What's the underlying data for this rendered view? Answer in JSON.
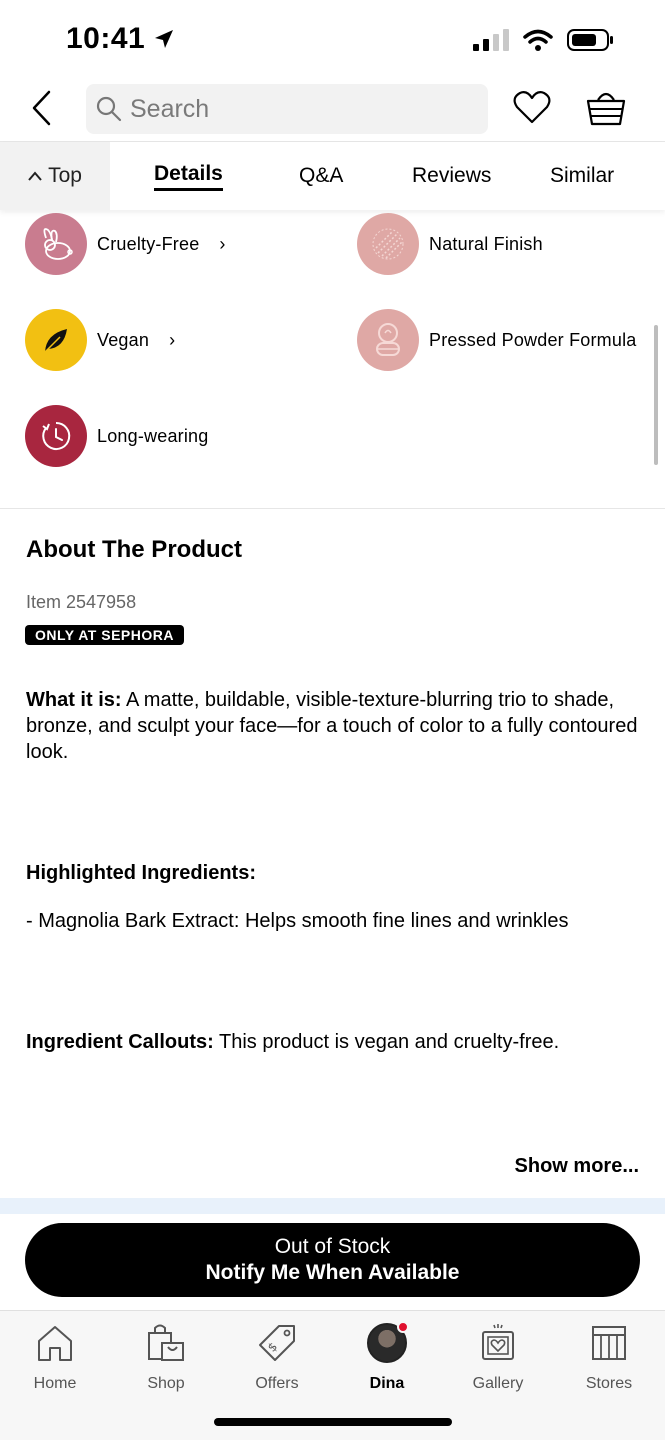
{
  "status": {
    "time": "10:41"
  },
  "search": {
    "placeholder": "Search"
  },
  "tabs": {
    "top": "Top",
    "items": [
      "Details",
      "Q&A",
      "Reviews",
      "Similar"
    ]
  },
  "features": [
    {
      "label": "Cruelty-Free",
      "icon": "rabbit-icon",
      "color": "#c97c8f"
    },
    {
      "label": "Natural Finish",
      "icon": "texture-icon",
      "color": "#dfa8a5"
    },
    {
      "label": "Vegan",
      "icon": "leaf-icon",
      "color": "#f2c012"
    },
    {
      "label": "Pressed Powder Formula",
      "icon": "compact-icon",
      "color": "#dfa8a5"
    },
    {
      "label": "Long-wearing",
      "icon": "timer-icon",
      "color": "#a8263f"
    }
  ],
  "about": {
    "title": "About The Product",
    "item_number": "Item 2547958",
    "badge": "ONLY AT SEPHORA",
    "what_it_is_label": "What it is:",
    "what_it_is_text": " A matte, buildable, visible-texture-blurring trio to shade, bronze, and sculpt your face—for a touch of color to a fully contoured look.",
    "highlighted_label": "Highlighted Ingredients:",
    "highlighted_item": "- Magnolia Bark Extract: Helps smooth fine lines and wrinkles",
    "callouts_label": "Ingredient Callouts:",
    "callouts_text": " This product is vegan and cruelty-free.",
    "show_more": "Show more..."
  },
  "cta": {
    "line1": "Out of Stock",
    "line2": "Notify Me When Available"
  },
  "bottom_nav": [
    {
      "label": "Home",
      "icon": "home-icon"
    },
    {
      "label": "Shop",
      "icon": "shopping-bag-icon"
    },
    {
      "label": "Offers",
      "icon": "tag-icon"
    },
    {
      "label": "Dina",
      "icon": "avatar"
    },
    {
      "label": "Gallery",
      "icon": "gallery-icon"
    },
    {
      "label": "Stores",
      "icon": "store-icon"
    }
  ],
  "colors": {
    "accent": "#000000",
    "badge_bg": "#000000",
    "band": "#e8f1fb"
  }
}
